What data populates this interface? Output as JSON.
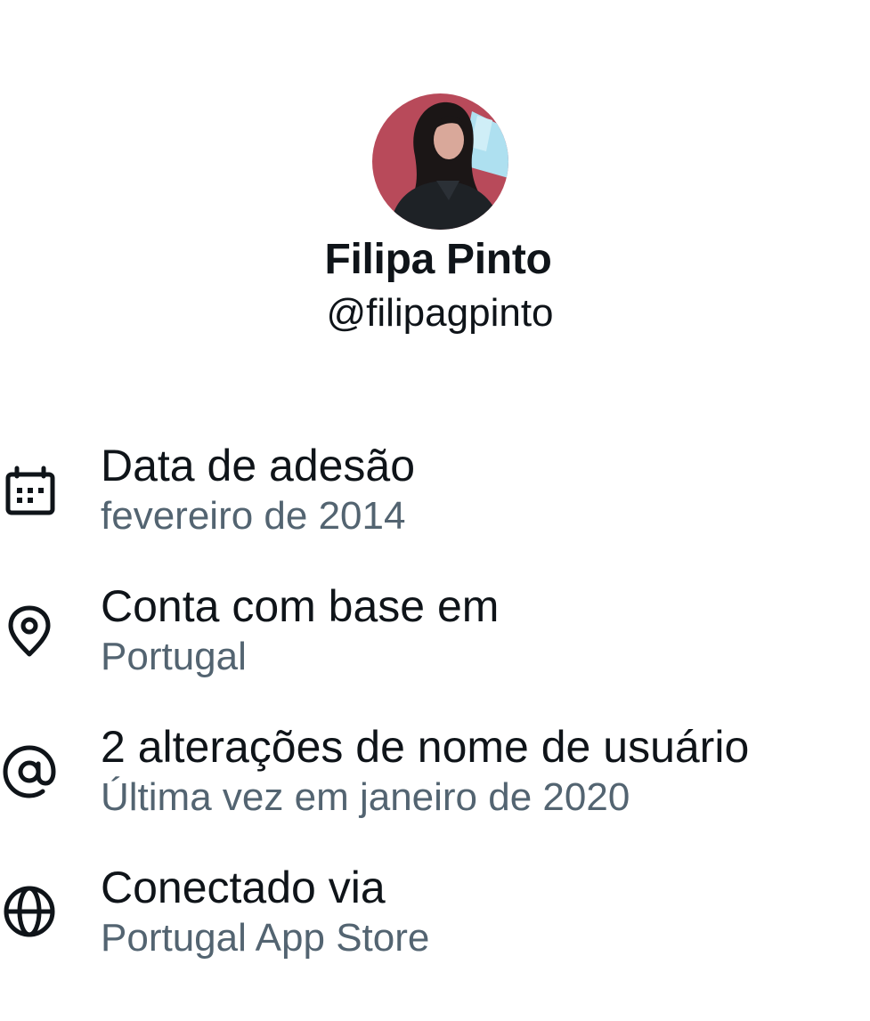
{
  "profile": {
    "display_name": "Filipa Pinto",
    "handle": "@filipagpinto"
  },
  "about": [
    {
      "icon": "calendar-icon",
      "title": "Data de adesão",
      "value": "fevereiro de 2014"
    },
    {
      "icon": "location-pin-icon",
      "title": "Conta com base em",
      "value": "Portugal"
    },
    {
      "icon": "at-sign-icon",
      "title": "2 alterações de nome de usuário",
      "value": "Última vez em janeiro de 2020"
    },
    {
      "icon": "globe-icon",
      "title": "Conectado via",
      "value": "Portugal App Store"
    }
  ],
  "colors": {
    "primary_text": "#0f1419",
    "secondary_text": "#536471",
    "background": "#ffffff"
  }
}
